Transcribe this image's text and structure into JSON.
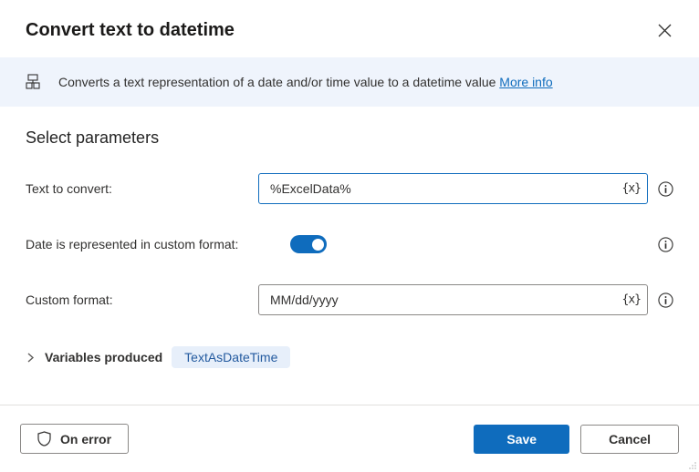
{
  "header": {
    "title": "Convert text to datetime"
  },
  "banner": {
    "text": "Converts a text representation of a date and/or time value to a datetime value ",
    "link": "More info"
  },
  "section_title": "Select parameters",
  "params": {
    "text_to_convert": {
      "label": "Text to convert:",
      "value": "%ExcelData%"
    },
    "custom_toggle": {
      "label": "Date is represented in custom format:"
    },
    "custom_format": {
      "label": "Custom format:",
      "value": "MM/dd/yyyy"
    }
  },
  "variables": {
    "label": "Variables produced",
    "chip": "TextAsDateTime"
  },
  "var_token": "{x}",
  "footer": {
    "on_error": "On error",
    "save": "Save",
    "cancel": "Cancel"
  }
}
